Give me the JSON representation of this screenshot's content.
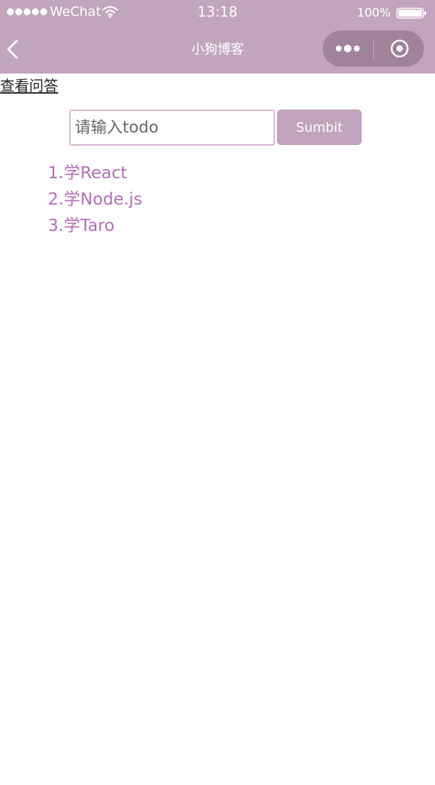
{
  "status_bar": {
    "carrier": "WeChat",
    "time": "13:18",
    "battery_percent": "100%",
    "signal_dots": 5,
    "icons": [
      "signal-dots-icon",
      "wifi-icon",
      "battery-icon"
    ]
  },
  "nav_bar": {
    "title": "小狗博客",
    "back_icon": "chevron-left-icon",
    "more_icon": "more-dots-icon",
    "close_icon": "circle-target-icon"
  },
  "content": {
    "qa_link": "查看问答",
    "input_placeholder": "请输入todo",
    "input_value": "",
    "submit_label": "Sumbit",
    "todos": [
      "1.学React",
      "2.学Node.js",
      "3.学Taro"
    ]
  },
  "colors": {
    "header_bg": "#c1a5bd",
    "todo_text": "#b36fb6",
    "input_border": "#d6b7d0",
    "button_bg": "#c1a5bd"
  }
}
